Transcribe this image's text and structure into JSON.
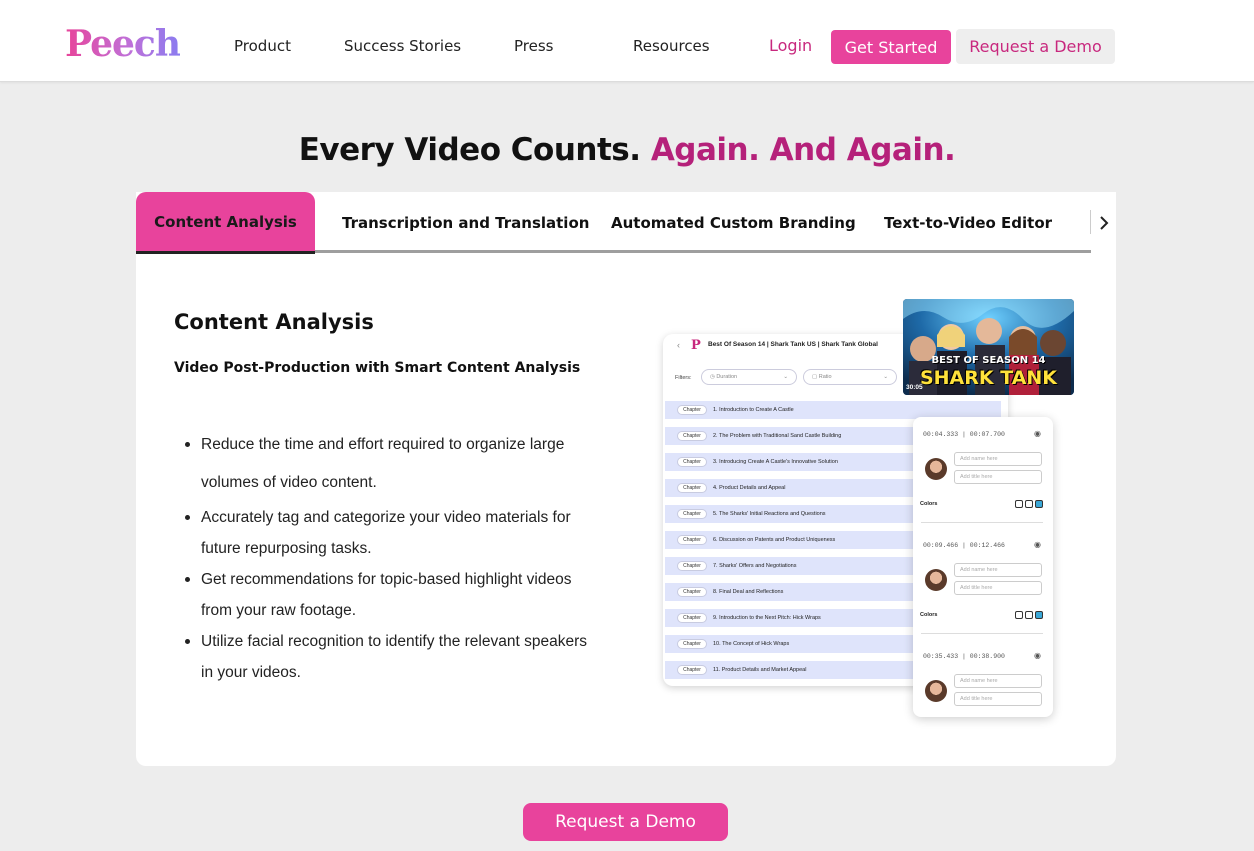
{
  "header": {
    "logo": "Peech",
    "nav": [
      "Product",
      "Success Stories",
      "Press",
      "Resources"
    ],
    "login": "Login",
    "get_started": "Get Started",
    "request_demo": "Request a Demo"
  },
  "headline": {
    "main": "Every Video Counts.",
    "accent": "Again. And Again."
  },
  "tabs": [
    {
      "label": "Content Analysis",
      "active": true
    },
    {
      "label": "Transcription and Translation",
      "active": false
    },
    {
      "label": "Automated Custom Branding",
      "active": false
    },
    {
      "label": "Text-to-Video Editor",
      "active": false
    }
  ],
  "tab_arrow_icon": "chevron-right-icon",
  "content": {
    "title": "Content Analysis",
    "subtitle": "Video Post-Production with Smart Content Analysis",
    "bullets": [
      "Reduce the time and effort required to organize large volumes of video content.",
      "Accurately tag and categorize your video materials for future repurposing tasks.",
      "Get recommendations for topic-based highlight videos from your raw footage.",
      "Utilize facial recognition to identify the relevant speakers in your videos."
    ]
  },
  "mockup": {
    "logo": "P",
    "title": "Best Of Season 14 | Shark Tank US | Shark Tank Global",
    "filters_label": "Filters:",
    "filter_duration": "Duration",
    "filter_ratio": "Ratio",
    "chip": "Chapter",
    "chapters": [
      "1. Introduction to Create A Castle",
      "2. The Problem with Traditional Sand Castle Building",
      "3. Introducing Create A Castle's Innovative Solution",
      "4. Product Details and Appeal",
      "5. The Sharks' Initial Reactions and Questions",
      "6. Discussion on Patents and Product Uniqueness",
      "7. Sharks' Offers and Negotiations",
      "8. Final Deal and Reflections",
      "9. Introduction to the Next Pitch: Hick Wraps",
      "10. The Concept of Hick Wraps",
      "11. Product Details and Market Appeal"
    ],
    "thumbnail": {
      "line1": "BEST OF SEASON 14",
      "line2": "SHARK TANK",
      "duration": "30:05"
    },
    "speakers": [
      {
        "time": "00:04.333  |  00:07.700",
        "name_ph": "Add name here",
        "title_ph": "Add title here",
        "colors_label": "Colors"
      },
      {
        "time": "00:09.466  |  00:12.466",
        "name_ph": "Add name here",
        "title_ph": "Add title here",
        "colors_label": "Colors"
      },
      {
        "time": "00:35.433  |  00:38.900",
        "name_ph": "Add name here",
        "title_ph": "Add title here"
      }
    ],
    "swatch_colors": [
      "#ffffff",
      "#ffffff",
      "#3aa8d8"
    ]
  },
  "footer_button": "Request a Demo",
  "colors": {
    "brand_pink": "#e8439c",
    "accent_magenta": "#b5217a",
    "page_bg": "#ededed"
  }
}
